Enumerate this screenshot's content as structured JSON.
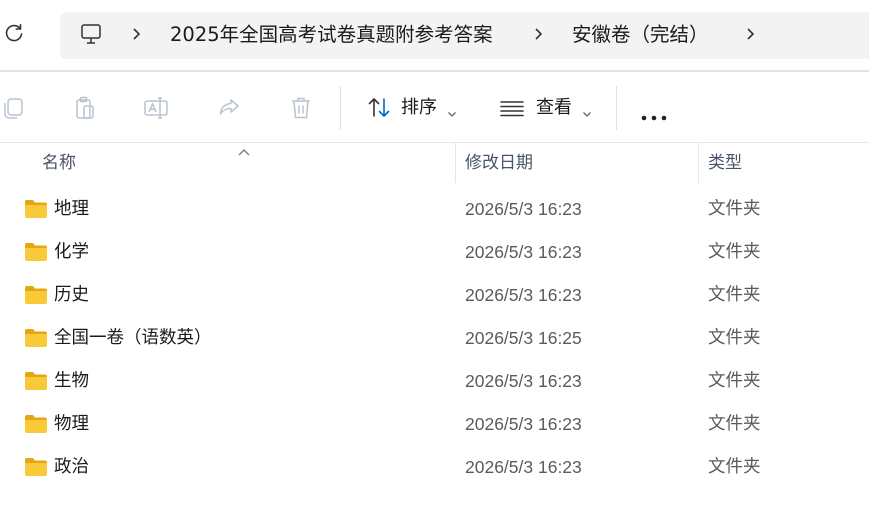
{
  "address_bar": {
    "breadcrumbs": [
      {
        "label": "2025年全国高考试卷真题附参考答案"
      },
      {
        "label": "安徽卷（完结）"
      }
    ]
  },
  "toolbar": {
    "sort_label": "排序",
    "view_label": "查看"
  },
  "columns": {
    "name": "名称",
    "date": "修改日期",
    "type": "类型"
  },
  "files": [
    {
      "name": "地理",
      "date": "2026/5/3 16:23",
      "type": "文件夹"
    },
    {
      "name": "化学",
      "date": "2026/5/3 16:23",
      "type": "文件夹"
    },
    {
      "name": "历史",
      "date": "2026/5/3 16:23",
      "type": "文件夹"
    },
    {
      "name": "全国一卷（语数英）",
      "date": "2026/5/3 16:25",
      "type": "文件夹"
    },
    {
      "name": "生物",
      "date": "2026/5/3 16:23",
      "type": "文件夹"
    },
    {
      "name": "物理",
      "date": "2026/5/3 16:23",
      "type": "文件夹"
    },
    {
      "name": "政治",
      "date": "2026/5/3 16:23",
      "type": "文件夹"
    }
  ],
  "colors": {
    "accent": "#0067c0",
    "folder_yellow": "#f8c938",
    "folder_dark": "#e5a711"
  }
}
